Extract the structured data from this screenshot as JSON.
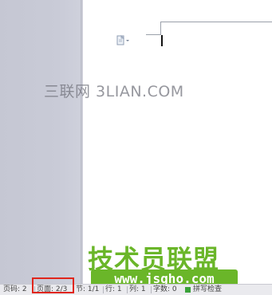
{
  "watermark_top": "三联网 3LIAN.COM",
  "watermark_bottom": {
    "title": "技术员联盟",
    "url": "www.jsgho.com"
  },
  "statusbar": {
    "page_number": "页码: 2",
    "page_count": "页面: 2/3",
    "section": "节: 1/1",
    "row": "行: 1",
    "column": "列: 1",
    "word_count": "字数: 0",
    "spell_check": "拼写检查"
  },
  "colors": {
    "highlight": "#e0261c",
    "watermark_green": "#6ab629"
  },
  "icons": {
    "paste_options": "paste-options-icon"
  }
}
